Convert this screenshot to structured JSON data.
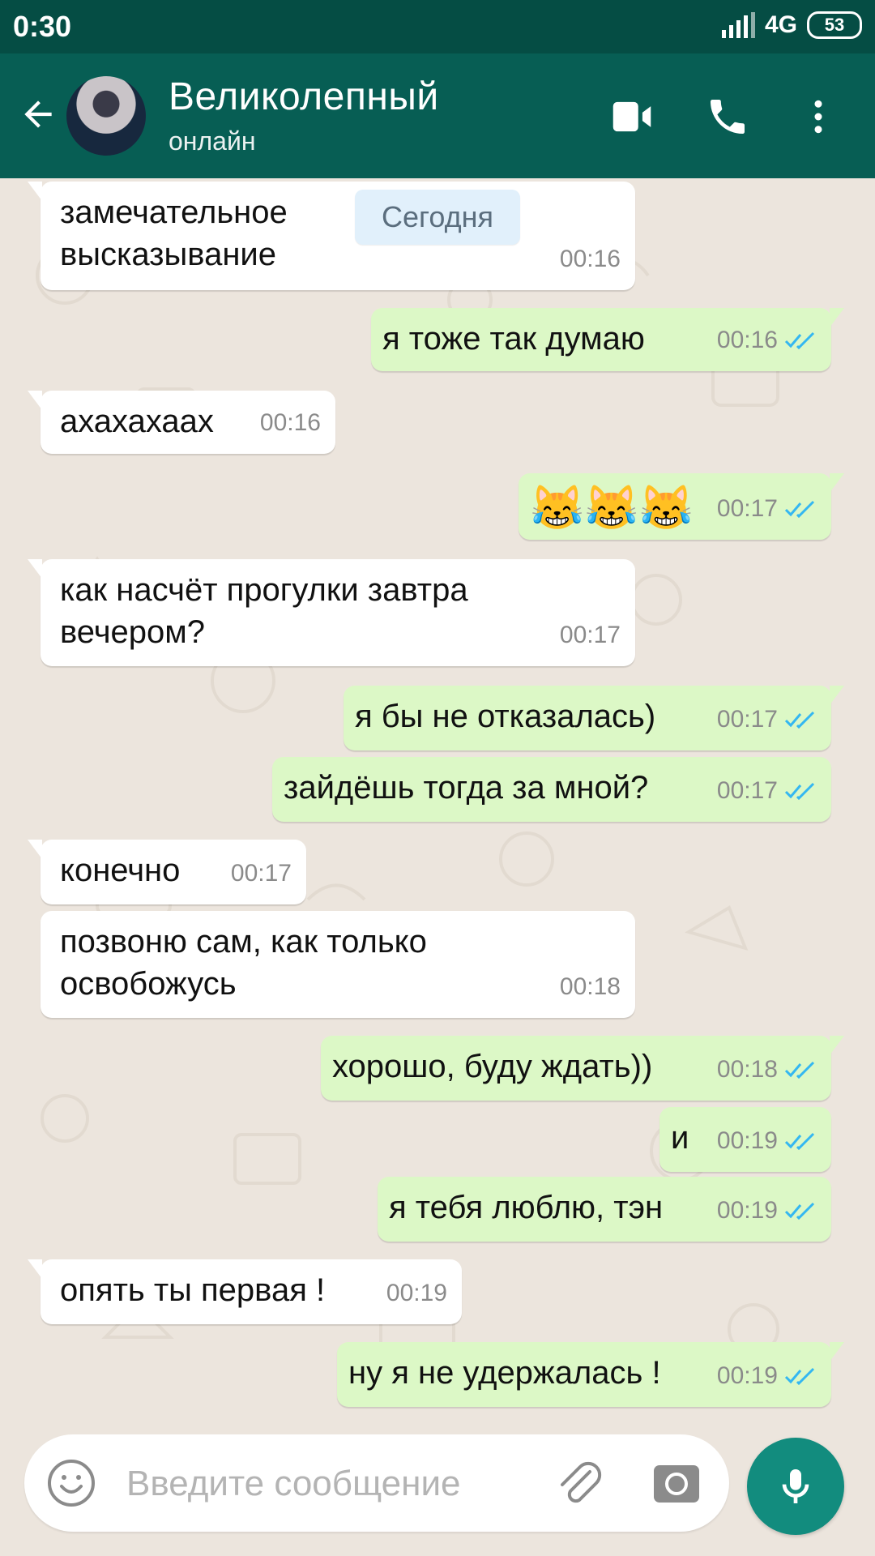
{
  "status_bar": {
    "time": "0:30",
    "network": "4G",
    "battery": "53"
  },
  "header": {
    "back_icon": "arrow-left-icon",
    "avatar_icon": "person-avatar",
    "contact_name": "Великолепный",
    "contact_status": "онлайн",
    "video_call_icon": "video-camera-icon",
    "voice_call_icon": "phone-icon",
    "menu_icon": "more-vertical-icon"
  },
  "chat": {
    "date_divider": "Сегодня",
    "messages": [
      {
        "direction": "incoming",
        "text": "замечательное\nвысказывание",
        "time": "00:16"
      },
      {
        "direction": "outgoing",
        "text": "я тоже так думаю",
        "time": "00:16",
        "status": "read"
      },
      {
        "direction": "incoming",
        "text": "ахахахаах",
        "time": "00:16"
      },
      {
        "direction": "outgoing",
        "text": "😹😹😹",
        "time": "00:17",
        "status": "read"
      },
      {
        "direction": "incoming",
        "text": "как насчёт прогулки завтра\nвечером?",
        "time": "00:17"
      },
      {
        "direction": "outgoing",
        "text": "я бы не отказалась)",
        "time": "00:17",
        "status": "read"
      },
      {
        "direction": "outgoing",
        "text": "зайдёшь тогда за мной?",
        "time": "00:17",
        "status": "read"
      },
      {
        "direction": "incoming",
        "text": "конечно",
        "time": "00:17"
      },
      {
        "direction": "incoming",
        "text": "позвоню сам, как только\nосвобожусь",
        "time": "00:18"
      },
      {
        "direction": "outgoing",
        "text": "хорошо, буду ждать))",
        "time": "00:18",
        "status": "read"
      },
      {
        "direction": "outgoing",
        "text": "и",
        "time": "00:19",
        "status": "read"
      },
      {
        "direction": "outgoing",
        "text": "я тебя люблю, тэн",
        "time": "00:19",
        "status": "read"
      },
      {
        "direction": "incoming",
        "text": "опять ты первая !",
        "time": "00:19"
      },
      {
        "direction": "outgoing",
        "text": "ну я не удержалась !",
        "time": "00:19",
        "status": "read"
      }
    ]
  },
  "composer": {
    "placeholder": "Введите сообщение",
    "emoji_icon": "emoji-icon",
    "attach_icon": "paperclip-icon",
    "camera_icon": "camera-icon",
    "mic_icon": "microphone-icon"
  },
  "colors": {
    "status_bar": "#054d44",
    "app_bar": "#075e54",
    "incoming_bubble": "#ffffff",
    "outgoing_bubble": "#dcf8c6",
    "read_ticks": "#34b7f1",
    "mic_button": "#128c7e"
  }
}
